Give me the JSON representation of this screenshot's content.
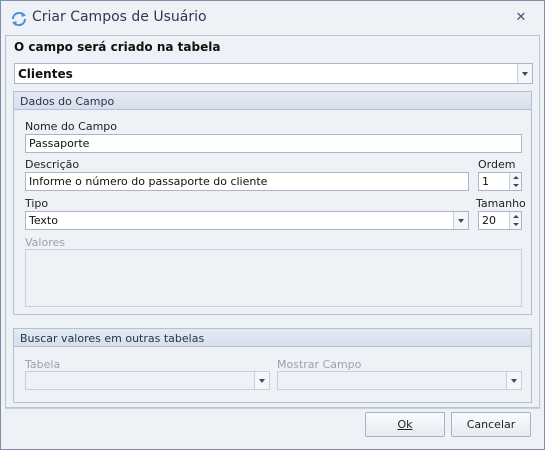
{
  "window": {
    "title": "Criar Campos de Usuário",
    "close_glyph": "✕"
  },
  "table_select": {
    "label": "O campo será criado na tabela",
    "value": "Clientes"
  },
  "field_group": {
    "header": "Dados do Campo",
    "name_label": "Nome do Campo",
    "name_value": "Passaporte",
    "description_label": "Descrição",
    "description_value": "Informe o número do passaporte do cliente",
    "order_label": "Ordem",
    "order_value": "1",
    "type_label": "Tipo",
    "type_value": "Texto",
    "size_label": "Tamanho",
    "size_value": "20",
    "values_label": "Valores"
  },
  "lookup_group": {
    "header": "Buscar valores em outras tabelas",
    "table_label": "Tabela",
    "table_value": "",
    "show_field_label": "Mostrar Campo",
    "show_field_value": ""
  },
  "buttons": {
    "ok_label": "Ok",
    "cancel_label": "Cancelar"
  },
  "icons": {
    "title_icon": "refresh-arrows-icon",
    "dropdown_icon": "chevron-down-icon",
    "spinner_icon": "spin-arrows-icon"
  },
  "colors": {
    "accent": "#4a90d9",
    "window_bg": "#eef1f6",
    "border": "#a9b6c9"
  }
}
